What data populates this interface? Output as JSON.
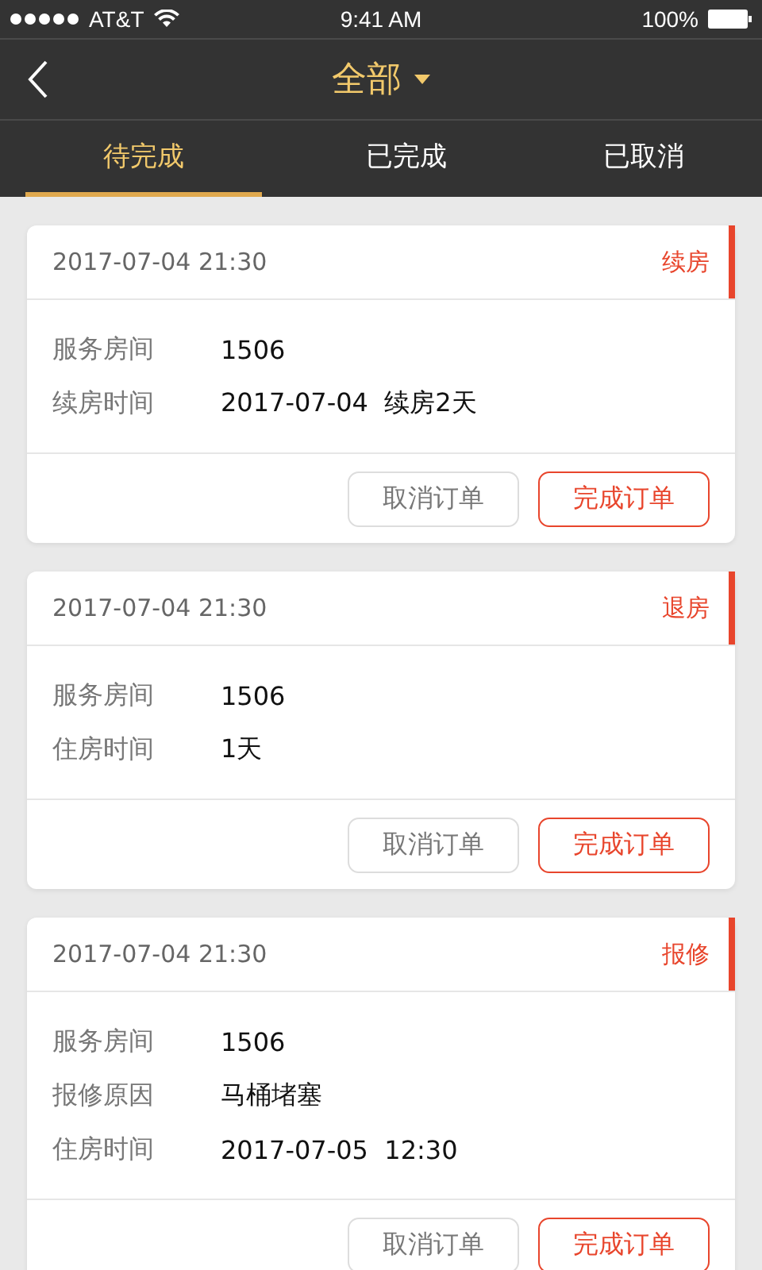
{
  "status_bar": {
    "carrier": "AT&T",
    "time": "9:41 AM",
    "battery": "100%"
  },
  "nav": {
    "title": "全部"
  },
  "tabs": [
    {
      "label": "待完成",
      "selected": true
    },
    {
      "label": "已完成",
      "selected": false
    },
    {
      "label": "已取消",
      "selected": false
    }
  ],
  "orders": [
    {
      "time": "2017-07-04 21:30",
      "type": "续房",
      "fields": [
        {
          "label": "服务房间",
          "value": "1506"
        },
        {
          "label": "续房时间",
          "value": "2017-07-04  续房2天"
        }
      ],
      "buttons": [
        "取消订单",
        "完成订单"
      ]
    },
    {
      "time": "2017-07-04 21:30",
      "type": "退房",
      "fields": [
        {
          "label": "服务房间",
          "value": "1506"
        },
        {
          "label": "住房时间",
          "value": "1天"
        }
      ],
      "buttons": [
        "取消订单",
        "完成订单"
      ]
    },
    {
      "time": "2017-07-04 21:30",
      "type": "报修",
      "fields": [
        {
          "label": "服务房间",
          "value": "1506"
        },
        {
          "label": "报修原因",
          "value": "马桶堵塞"
        },
        {
          "label": "住房时间",
          "value": "2017-07-05  12:30"
        }
      ],
      "buttons": [
        "取消订单",
        "完成订单"
      ]
    }
  ]
}
